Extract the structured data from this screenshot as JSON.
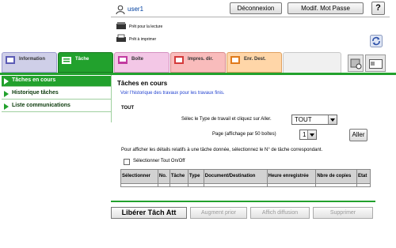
{
  "header": {
    "username": "user1",
    "logout_label": "Déconnexion",
    "change_password_label": "Modif. Mot Passe",
    "help_label": "?",
    "scan_status": "Prêt pour la lecture",
    "print_status": "Prêt à imprimer"
  },
  "tabs": [
    {
      "label": "Information",
      "icon": "info-icon"
    },
    {
      "label": "Tâche",
      "icon": "job-icon",
      "active": true
    },
    {
      "label": "Boîte",
      "icon": "box-icon"
    },
    {
      "label": "Impres. dir.",
      "icon": "direct-print-icon"
    },
    {
      "label": "Enr. Dest.",
      "icon": "store-address-icon"
    }
  ],
  "sidebar": {
    "items": [
      {
        "label": "Tâches en cours",
        "active": true
      },
      {
        "label": "Historique tâches"
      },
      {
        "label": "Liste communications"
      }
    ]
  },
  "main": {
    "title": "Tâches en cours",
    "history_link": "Voir l'historique des travaux pour les travaux finis.",
    "section": "TOUT",
    "type_label": "Sélec le Type de travail et cliquez sur Aller.",
    "type_value": "TOUT",
    "page_label": "Page (affichage par 50 boîtes)",
    "page_value": "1",
    "go_label": "Aller",
    "hint": "Pour afficher les détails relatifs à une tâche donnée, sélectionnez le N° de tâche correspondant.",
    "select_all_label": "Sélectionner Tout On/Off",
    "columns": [
      "Sélectionner",
      "No.",
      "Tâche",
      "Type",
      "Document/Destination",
      "Heure enregistrée",
      "Nbre de copies",
      "Etat"
    ]
  },
  "actions": {
    "release_label": "Libérer Tâch Att",
    "raise_priority_label": "Augment prior",
    "show_diffusion_label": "Affich diffusion",
    "delete_label": "Supprimer"
  },
  "colors": {
    "accent": "#22a12d",
    "link": "#1f3fcf"
  }
}
